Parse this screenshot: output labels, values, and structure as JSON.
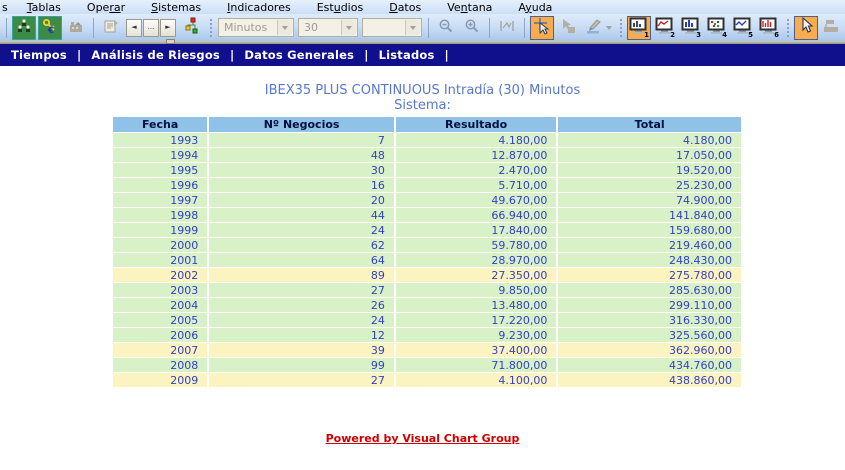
{
  "menu": {
    "cut_label": "s",
    "items": [
      {
        "label": "Tablas",
        "u": 0,
        "ulen": 1
      },
      {
        "label": "Operar",
        "u": 3,
        "ulen": 2
      },
      {
        "label": "Sistemas",
        "u": 0,
        "ulen": 1
      },
      {
        "label": "Indicadores",
        "u": 0,
        "ulen": 1
      },
      {
        "label": "Estudios",
        "u": 3,
        "ulen": 1
      },
      {
        "label": "Datos",
        "u": 0,
        "ulen": 1
      },
      {
        "label": "Ventana",
        "u": 2,
        "ulen": 1
      },
      {
        "label": "Ayuda",
        "u": 1,
        "ulen": 1
      }
    ]
  },
  "toolbar": {
    "nav_buttons": {
      "prev": "◄",
      "more": "...",
      "next": "►"
    },
    "dropdowns": [
      {
        "name": "compression-units",
        "value": "Minutos"
      },
      {
        "name": "compression-count",
        "value": "30"
      },
      {
        "name": "extra",
        "value": ""
      }
    ],
    "chart_buttons": [
      {
        "n": "1",
        "variant": "bars-dark",
        "selected": true
      },
      {
        "n": "2",
        "variant": "line-red",
        "selected": false
      },
      {
        "n": "3",
        "variant": "bars-blue",
        "selected": false
      },
      {
        "n": "4",
        "variant": "dots",
        "selected": false
      },
      {
        "n": "5",
        "variant": "line-blue",
        "selected": false
      },
      {
        "n": "6",
        "variant": "bars-red",
        "selected": false
      }
    ]
  },
  "tabs": {
    "separator": "|",
    "items": [
      "Tiempos",
      "Análisis de Riesgos",
      "Datos Generales",
      "Listados"
    ]
  },
  "report": {
    "title": "IBEX35 PLUS CONTINUOUS Intradía (30) Minutos",
    "subtitle": "Sistema:",
    "table": {
      "columns": [
        "Fecha",
        "Nº Negocios",
        "Resultado",
        "Total"
      ],
      "rows": [
        {
          "fecha": "1993",
          "negocios": "7",
          "resultado": "4.180,00",
          "total": "4.180,00",
          "hl": false
        },
        {
          "fecha": "1994",
          "negocios": "48",
          "resultado": "12.870,00",
          "total": "17.050,00",
          "hl": false
        },
        {
          "fecha": "1995",
          "negocios": "30",
          "resultado": "2.470,00",
          "total": "19.520,00",
          "hl": false
        },
        {
          "fecha": "1996",
          "negocios": "16",
          "resultado": "5.710,00",
          "total": "25.230,00",
          "hl": false
        },
        {
          "fecha": "1997",
          "negocios": "20",
          "resultado": "49.670,00",
          "total": "74.900,00",
          "hl": false
        },
        {
          "fecha": "1998",
          "negocios": "44",
          "resultado": "66.940,00",
          "total": "141.840,00",
          "hl": false
        },
        {
          "fecha": "1999",
          "negocios": "24",
          "resultado": "17.840,00",
          "total": "159.680,00",
          "hl": false
        },
        {
          "fecha": "2000",
          "negocios": "62",
          "resultado": "59.780,00",
          "total": "219.460,00",
          "hl": false
        },
        {
          "fecha": "2001",
          "negocios": "64",
          "resultado": "28.970,00",
          "total": "248.430,00",
          "hl": false
        },
        {
          "fecha": "2002",
          "negocios": "89",
          "resultado": "27.350,00",
          "total": "275.780,00",
          "hl": true
        },
        {
          "fecha": "2003",
          "negocios": "27",
          "resultado": "9.850,00",
          "total": "285.630,00",
          "hl": false
        },
        {
          "fecha": "2004",
          "negocios": "26",
          "resultado": "13.480,00",
          "total": "299.110,00",
          "hl": false
        },
        {
          "fecha": "2005",
          "negocios": "24",
          "resultado": "17.220,00",
          "total": "316.330,00",
          "hl": false
        },
        {
          "fecha": "2006",
          "negocios": "12",
          "resultado": "9.230,00",
          "total": "325.560,00",
          "hl": false
        },
        {
          "fecha": "2007",
          "negocios": "39",
          "resultado": "37.400,00",
          "total": "362.960,00",
          "hl": true
        },
        {
          "fecha": "2008",
          "negocios": "99",
          "resultado": "71.800,00",
          "total": "434.760,00",
          "hl": false
        },
        {
          "fecha": "2009",
          "negocios": "27",
          "resultado": "4.100,00",
          "total": "438.860,00",
          "hl": true
        }
      ]
    },
    "footer_link": "Powered by Visual Chart Group"
  },
  "colors": {
    "tabbar_bg": "#10108C",
    "header_bg": "#8FC2E6",
    "row_green": "#D9F1C6",
    "row_yellow": "#FCF4C0",
    "cell_text": "#3340C8",
    "title_text": "#5878CC",
    "link_red": "#D00000",
    "selected_button": "#F9AC4E",
    "green_button": "#3D8B46"
  }
}
